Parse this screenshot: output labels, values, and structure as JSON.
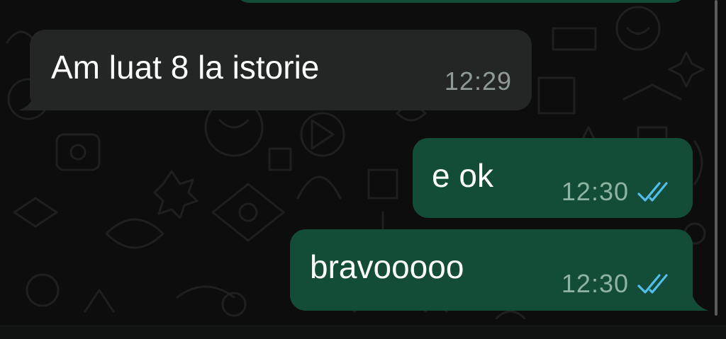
{
  "messages": [
    {
      "direction": "incoming",
      "text": "Am luat 8 la istorie",
      "time": "12:29"
    },
    {
      "direction": "outgoing",
      "text": "e ok",
      "time": "12:30",
      "status": "read",
      "status_icon": "double-check-icon"
    },
    {
      "direction": "outgoing",
      "text": "bravooooo",
      "time": "12:30",
      "status": "read",
      "status_icon": "double-check-icon"
    }
  ],
  "colors": {
    "background": "#0d0d0d",
    "incoming_bubble": "#242626",
    "outgoing_bubble": "#144d37",
    "read_ticks": "#53bdeb",
    "text": "#ffffff"
  }
}
